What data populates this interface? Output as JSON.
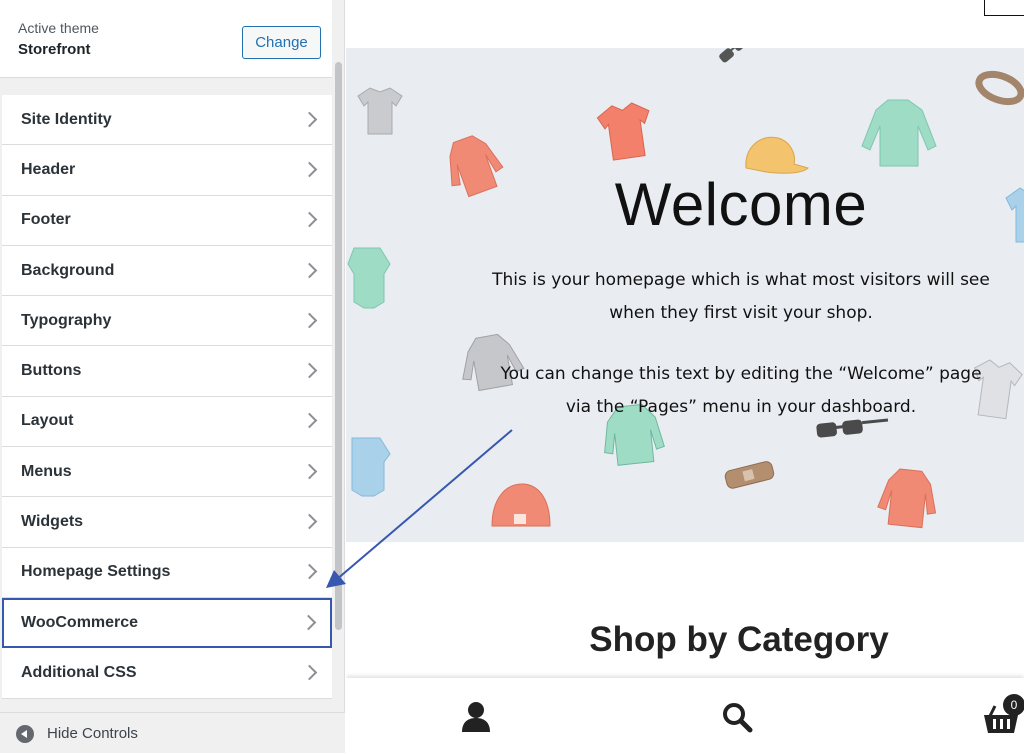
{
  "sidebar": {
    "active_theme_label": "Active theme",
    "active_theme_name": "Storefront",
    "change_button": "Change",
    "items": [
      {
        "label": "Site Identity"
      },
      {
        "label": "Header"
      },
      {
        "label": "Footer"
      },
      {
        "label": "Background"
      },
      {
        "label": "Typography"
      },
      {
        "label": "Buttons"
      },
      {
        "label": "Layout"
      },
      {
        "label": "Menus"
      },
      {
        "label": "Widgets"
      },
      {
        "label": "Homepage Settings"
      },
      {
        "label": "WooCommerce",
        "selected": true
      },
      {
        "label": "Additional CSS"
      }
    ],
    "hide_controls": "Hide Controls"
  },
  "preview": {
    "hero": {
      "title": "Welcome",
      "paragraph1": "This is your homepage which is what most visitors will see when they first visit your shop.",
      "paragraph2": "You can change this text by editing the “Welcome” page via the “Pages” menu in your dashboard."
    },
    "section_heading": "Shop by Category",
    "bottom_bar": {
      "account_icon": "user-icon",
      "search_icon": "search-icon",
      "cart_icon": "basket-icon",
      "cart_count": "0"
    }
  },
  "colors": {
    "accent_blue": "#2271b1",
    "highlight_outline": "#3858b0",
    "hero_background": "#e9edf1"
  }
}
